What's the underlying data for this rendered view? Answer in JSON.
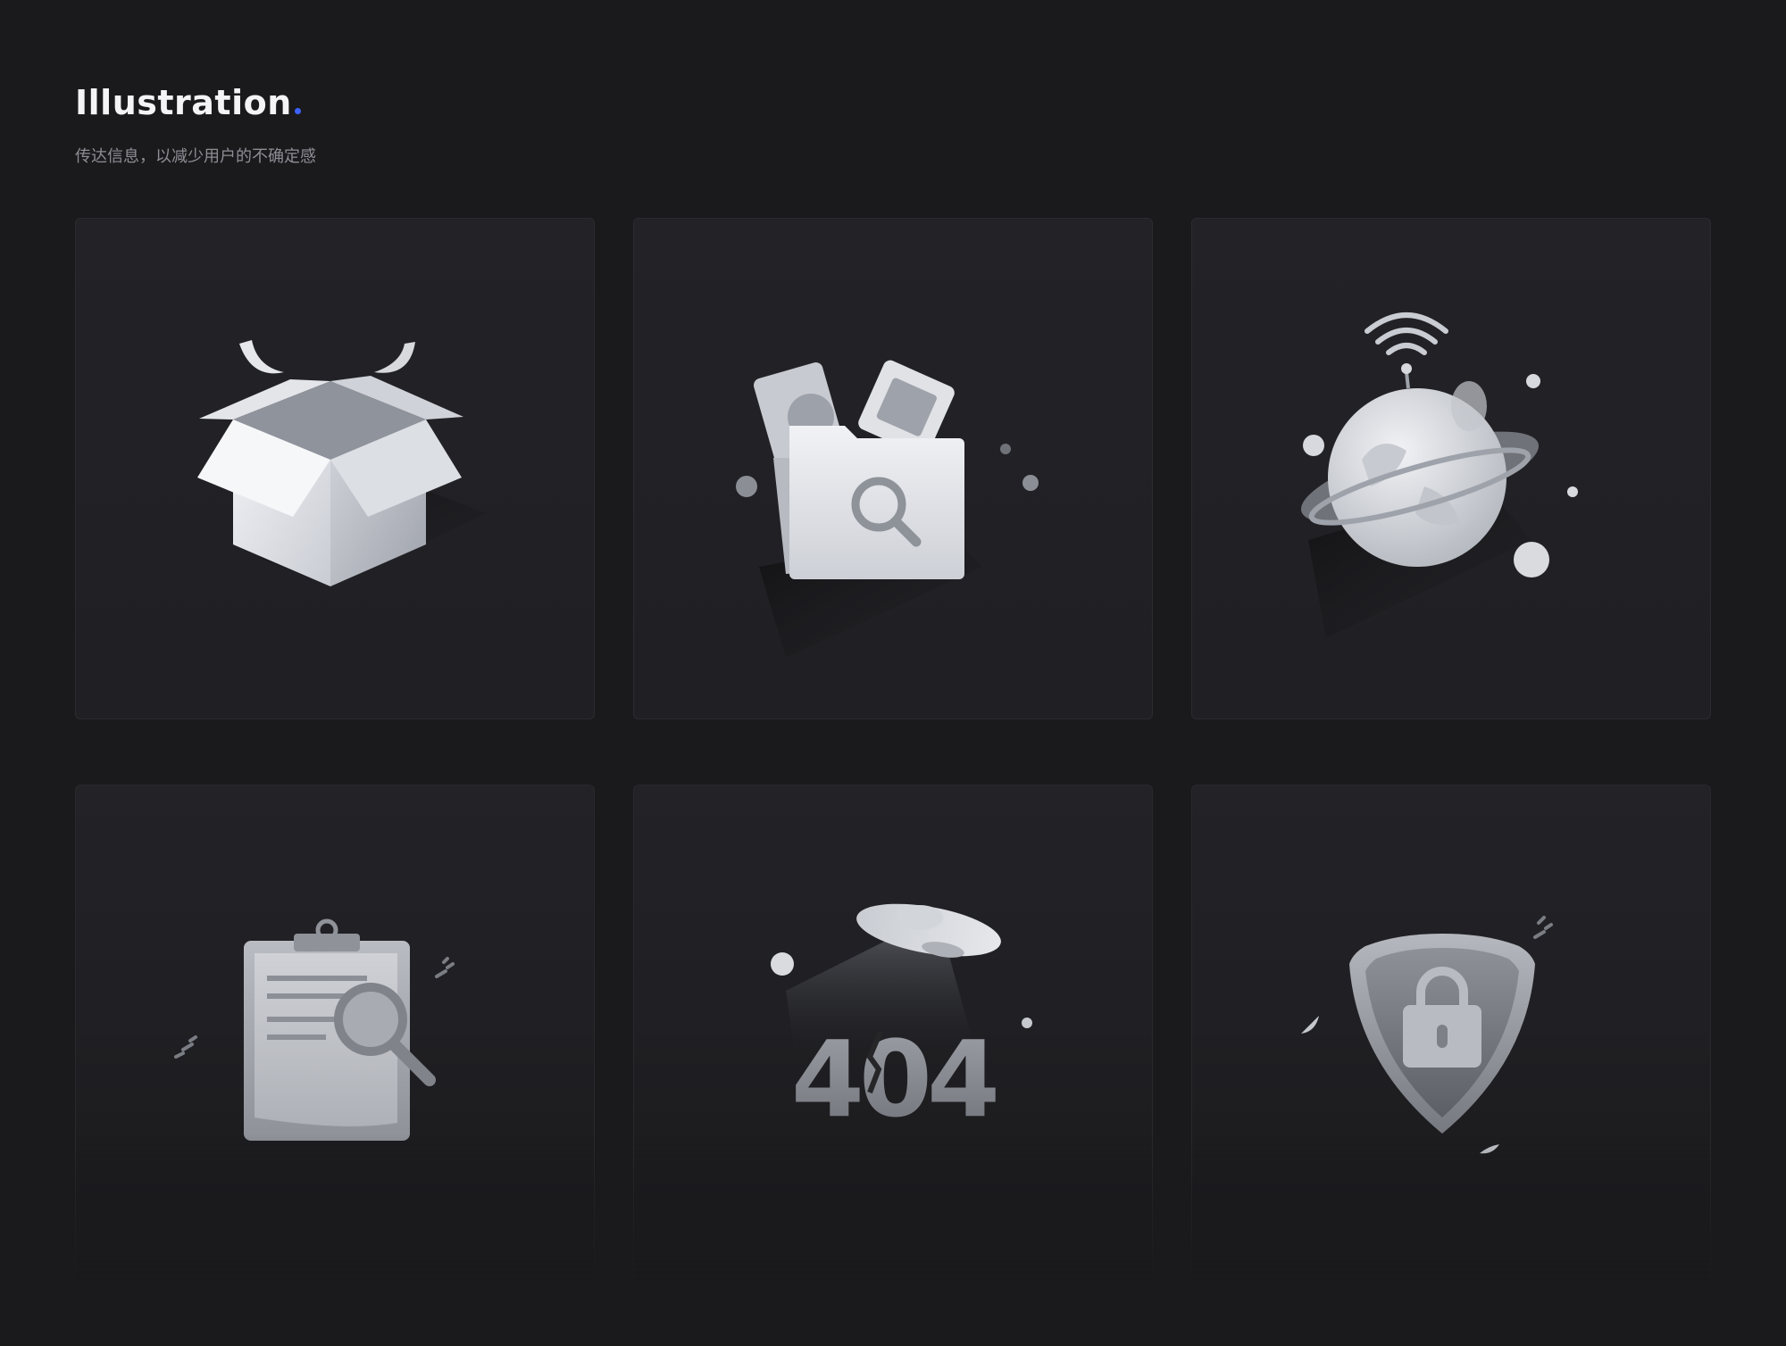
{
  "header": {
    "title": "Illustration",
    "subtitle": "传达信息，以减少用户的不确定感",
    "accent_color": "#3d63ff"
  },
  "illustrations": [
    {
      "id": "open-box",
      "icon": "open-box-icon"
    },
    {
      "id": "folder-search",
      "icon": "folder-search-icon"
    },
    {
      "id": "planet-signal",
      "icon": "planet-wifi-icon"
    },
    {
      "id": "clipboard-search",
      "icon": "clipboard-search-icon"
    },
    {
      "id": "404-ufo",
      "icon": "404-ufo-icon",
      "text": "404"
    },
    {
      "id": "shield-lock",
      "icon": "shield-lock-icon"
    }
  ],
  "colors": {
    "background": "#1a1a1d",
    "card": "#222226",
    "illustration_light": "#e9ebf0",
    "illustration_mid": "#a7aab2",
    "illustration_dark": "#6f727a"
  }
}
